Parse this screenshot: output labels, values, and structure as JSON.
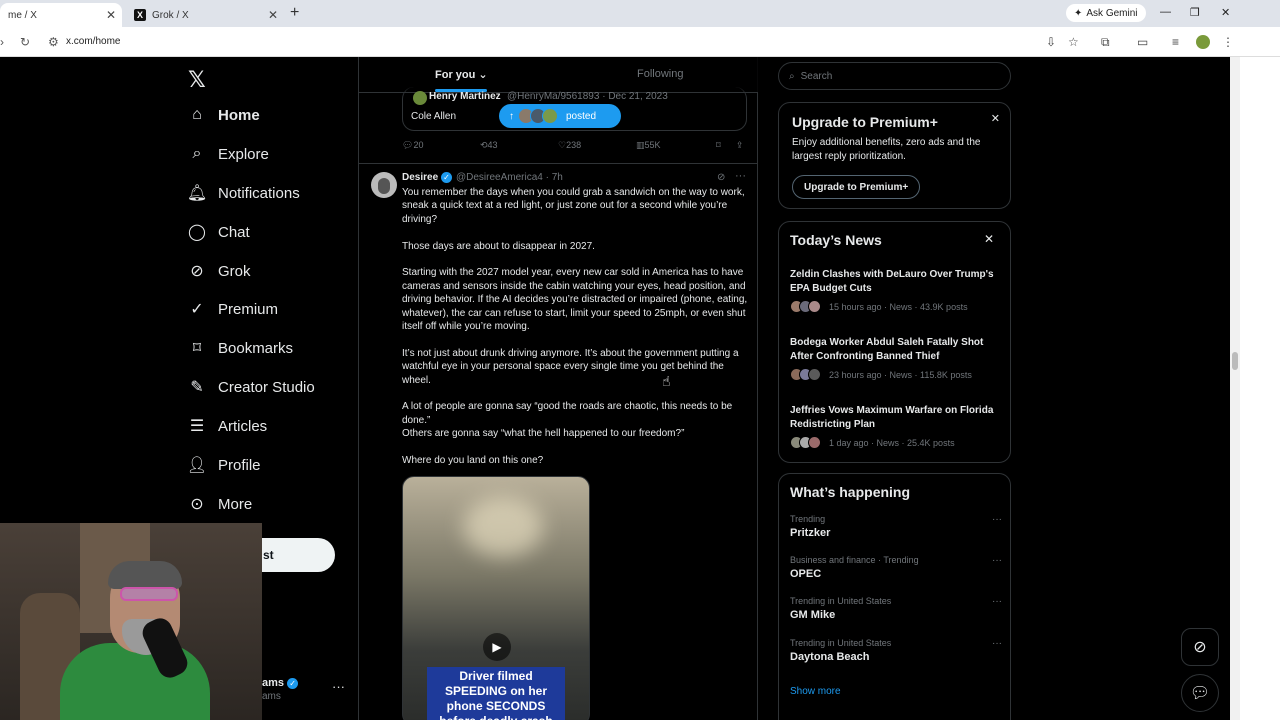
{
  "browser": {
    "tabs": [
      {
        "label": "me / X",
        "active": true
      },
      {
        "label": "Grok / X",
        "active": false
      }
    ],
    "ask_gemini": "Ask Gemini",
    "url": "x.com/home"
  },
  "nav": {
    "items": [
      {
        "label": "Home",
        "icon": "home-icon"
      },
      {
        "label": "Explore",
        "icon": "search-icon"
      },
      {
        "label": "Notifications",
        "icon": "bell-icon"
      },
      {
        "label": "Chat",
        "icon": "chat-icon"
      },
      {
        "label": "Grok",
        "icon": "grok-icon"
      },
      {
        "label": "Premium",
        "icon": "premium-icon"
      },
      {
        "label": "Bookmarks",
        "icon": "bookmark-icon"
      },
      {
        "label": "Creator Studio",
        "icon": "creator-icon"
      },
      {
        "label": "Articles",
        "icon": "articles-icon"
      },
      {
        "label": "Profile",
        "icon": "profile-icon"
      },
      {
        "label": "More",
        "icon": "more-icon"
      }
    ],
    "post_label": "st",
    "account_name": "ams",
    "account_handle": "ams"
  },
  "timeline": {
    "tab_for_you": "For you",
    "tab_following": "Following",
    "quote": {
      "name": "Henry Martinez",
      "handle": "@HenryMa/9561893 · Dec 21, 2023",
      "text": "Cole Allen"
    },
    "posted_pill": "posted",
    "actions": {
      "replies": "20",
      "reposts": "43",
      "likes": "238",
      "views": "55K"
    },
    "tweet": {
      "name": "Desiree",
      "handle": "@DesireeAmerica4 · 7h",
      "p1": "You remember the days when you could grab a sandwich on the way to work, sneak a quick text at a red light, or just zone out for a second while you’re driving?",
      "p2": "Those days are about to disappear in 2027.",
      "p3": "Starting with the 2027 model year, every new car sold in America has to have cameras and sensors inside the cabin watching your eyes, head position, and driving behavior. If the AI decides you’re distracted or impaired (phone, eating, whatever), the car can refuse to start, limit your speed to 25mph, or even shut itself off while you’re moving.",
      "p4": "It’s not just about drunk driving anymore. It’s about the government putting a watchful eye in your personal space every single time you get behind the wheel.",
      "p5a": "A lot of people are gonna say “good the roads are chaotic, this needs to be done.”",
      "p5b": "Others are gonna say “what the hell happened to our freedom?”",
      "p6": "Where do you land on this one?",
      "caption": "Driver filmed SPEEDING on her phone SECONDS before deadly crash"
    }
  },
  "sidebar": {
    "search_placeholder": "Search",
    "premium": {
      "title": "Upgrade to Premium+",
      "desc": "Enjoy additional benefits, zero ads and the largest reply prioritization.",
      "button": "Upgrade to Premium+"
    },
    "news": {
      "title": "Today’s News",
      "items": [
        {
          "headline": "Zeldin Clashes with DeLauro Over Trump's EPA Budget Cuts",
          "meta": "15 hours ago · News · 43.9K posts"
        },
        {
          "headline": "Bodega Worker Abdul Saleh Fatally Shot After Confronting Banned Thief",
          "meta": "23 hours ago · News · 115.8K posts"
        },
        {
          "headline": "Jeffries Vows Maximum Warfare on Florida Redistricting Plan",
          "meta": "1 day ago · News · 25.4K posts"
        }
      ]
    },
    "happening": {
      "title": "What’s happening",
      "trends": [
        {
          "context": "Trending",
          "name": "Pritzker"
        },
        {
          "context": "Business and finance · Trending",
          "name": "OPEC"
        },
        {
          "context": "Trending in United States",
          "name": "GM Mike"
        },
        {
          "context": "Trending in United States",
          "name": "Daytona Beach"
        }
      ],
      "show_more": "Show more"
    }
  }
}
